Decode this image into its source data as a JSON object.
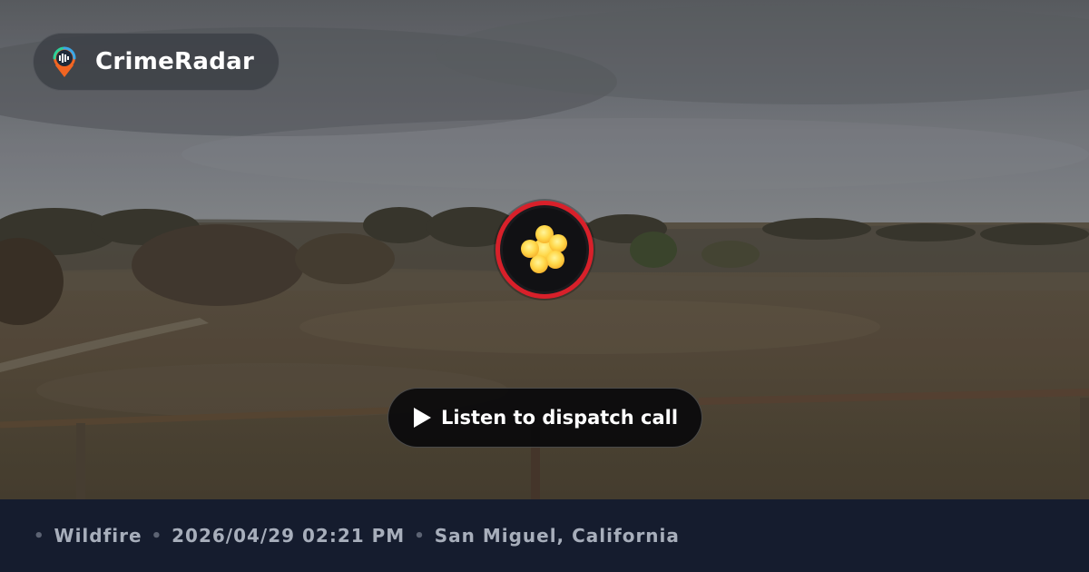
{
  "brand": {
    "name": "CrimeRadar",
    "logo_icon": "radar-pin-icon"
  },
  "incident": {
    "icon": "fire-burst-icon",
    "badge_ring_color": "#d8202a",
    "category": "Wildfire",
    "datetime": "2026/04/29 02:21 PM",
    "location": "San Miguel, California"
  },
  "player": {
    "play_icon": "play-icon",
    "label": "Listen to dispatch call"
  },
  "info_bar": {
    "separator": "•",
    "background_color": "#151c2e"
  }
}
